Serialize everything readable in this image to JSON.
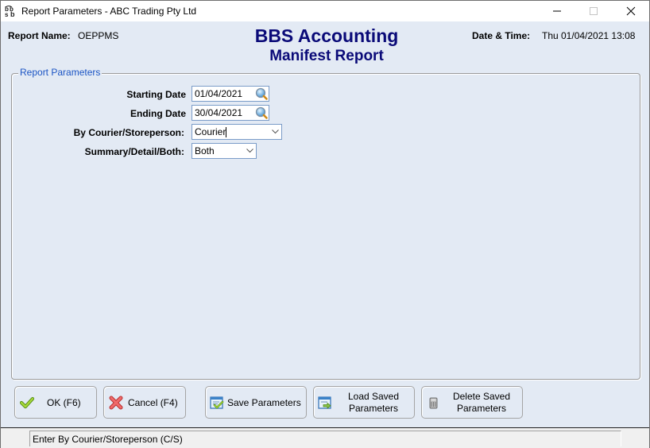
{
  "window": {
    "title": "Report Parameters - ABC Trading Pty Ltd",
    "app_icon": "bbs-logo-icon",
    "controls": [
      "minimize-icon",
      "maximize-icon",
      "close-icon"
    ]
  },
  "header": {
    "report_name_label": "Report Name:",
    "report_name_value": "OEPPMS",
    "brand_title": "BBS Accounting",
    "report_title": "Manifest Report",
    "datetime_label": "Date & Time:",
    "datetime_value": "Thu 01/04/2021 13:08"
  },
  "parameters": {
    "group_title": "Report Parameters",
    "fields": [
      {
        "label": "Starting Date",
        "value": "01/04/2021",
        "type": "date",
        "icon": "magnifier-icon"
      },
      {
        "label": "Ending Date",
        "value": "30/04/2021",
        "type": "date",
        "icon": "magnifier-icon"
      },
      {
        "label": "By Courier/Storeperson:",
        "value": "Courier",
        "type": "combo",
        "icon": "chevron-down-icon"
      },
      {
        "label": "Summary/Detail/Both:",
        "value": "Both",
        "type": "combo",
        "icon": "chevron-down-icon"
      }
    ]
  },
  "buttons": {
    "ok": {
      "label": "OK (F6)",
      "icon": "checkmark-icon"
    },
    "cancel": {
      "label": "Cancel (F4)",
      "icon": "cross-icon"
    },
    "save": {
      "label": "Save Parameters",
      "icon": "save-form-icon"
    },
    "load": {
      "label_line1": "Load Saved",
      "label_line2": "Parameters",
      "icon": "load-form-icon"
    },
    "delete": {
      "label_line1": "Delete Saved",
      "label_line2": "Parameters",
      "icon": "trash-bin-icon"
    }
  },
  "status": {
    "message": "Enter By Courier/Storeperson (C/S)"
  },
  "colors": {
    "background": "#e3eaf4",
    "brand": "#0a0a78",
    "group_title": "#1c55c4",
    "input_border": "#7a9cc8"
  }
}
